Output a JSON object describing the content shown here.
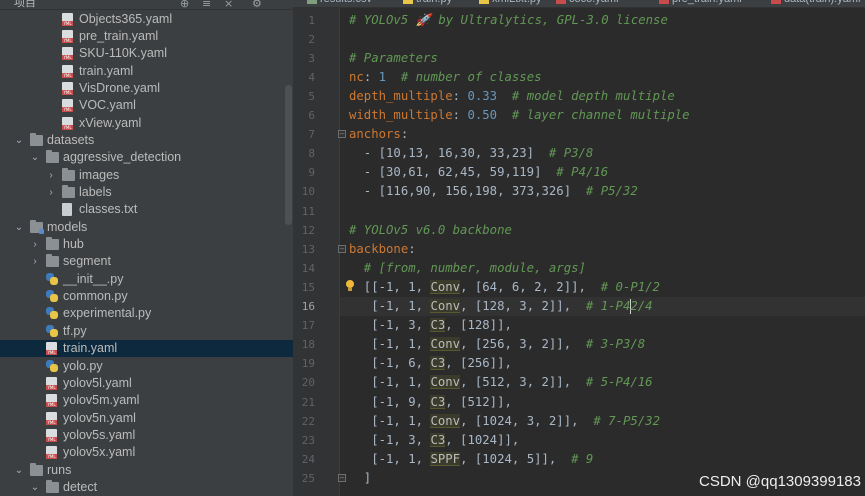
{
  "sidebar": {
    "project_label": "项目",
    "items": [
      {
        "label": "Objects365.yaml",
        "type": "yaml",
        "depth": 2
      },
      {
        "label": "pre_train.yaml",
        "type": "yaml",
        "depth": 2
      },
      {
        "label": "SKU-110K.yaml",
        "type": "yaml",
        "depth": 2
      },
      {
        "label": "train.yaml",
        "type": "yaml",
        "depth": 2
      },
      {
        "label": "VisDrone.yaml",
        "type": "yaml",
        "depth": 2
      },
      {
        "label": "VOC.yaml",
        "type": "yaml",
        "depth": 2
      },
      {
        "label": "xView.yaml",
        "type": "yaml",
        "depth": 2
      },
      {
        "label": "datasets",
        "type": "folder",
        "depth": 0,
        "expanded": true
      },
      {
        "label": "aggressive_detection",
        "type": "folder",
        "depth": 1,
        "expanded": true
      },
      {
        "label": "images",
        "type": "folder",
        "depth": 2,
        "expanded": false
      },
      {
        "label": "labels",
        "type": "folder",
        "depth": 2,
        "expanded": false
      },
      {
        "label": "classes.txt",
        "type": "txt",
        "depth": 2
      },
      {
        "label": "models",
        "type": "folder-mod",
        "depth": 0,
        "expanded": true
      },
      {
        "label": "hub",
        "type": "folder",
        "depth": 1,
        "expanded": false
      },
      {
        "label": "segment",
        "type": "folder",
        "depth": 1,
        "expanded": false
      },
      {
        "label": "__init__.py",
        "type": "py",
        "depth": 1
      },
      {
        "label": "common.py",
        "type": "py",
        "depth": 1
      },
      {
        "label": "experimental.py",
        "type": "py",
        "depth": 1
      },
      {
        "label": "tf.py",
        "type": "py",
        "depth": 1
      },
      {
        "label": "train.yaml",
        "type": "yaml",
        "depth": 1,
        "selected": true
      },
      {
        "label": "yolo.py",
        "type": "py",
        "depth": 1
      },
      {
        "label": "yolov5l.yaml",
        "type": "yaml",
        "depth": 1
      },
      {
        "label": "yolov5m.yaml",
        "type": "yaml",
        "depth": 1
      },
      {
        "label": "yolov5n.yaml",
        "type": "yaml",
        "depth": 1
      },
      {
        "label": "yolov5s.yaml",
        "type": "yaml",
        "depth": 1
      },
      {
        "label": "yolov5x.yaml",
        "type": "yaml",
        "depth": 1
      },
      {
        "label": "runs",
        "type": "folder",
        "depth": 0,
        "expanded": true
      },
      {
        "label": "detect",
        "type": "folder",
        "depth": 1,
        "expanded": true
      }
    ]
  },
  "tabs": [
    {
      "label": "results.csv",
      "icon": "csv"
    },
    {
      "label": "train.py",
      "icon": "py"
    },
    {
      "label": "xmlLtxt.py",
      "icon": "py"
    },
    {
      "label": "coco.yaml",
      "icon": "yaml"
    },
    {
      "label": "pre_train.yaml",
      "icon": "yaml"
    },
    {
      "label": "data(train).yaml",
      "icon": "yaml"
    }
  ],
  "editor": {
    "current_line": 16,
    "lines": [
      [
        {
          "t": "# YOLOv5 🚀 by Ultralytics, GPL-3.0 license",
          "c": "comment"
        }
      ],
      [],
      [
        {
          "t": "# Parameters",
          "c": "comment"
        }
      ],
      [
        {
          "t": "nc",
          "c": "key"
        },
        {
          "t": ": ",
          "c": "sym"
        },
        {
          "t": "1",
          "c": "num"
        },
        {
          "t": "  # number of classes",
          "c": "comment"
        }
      ],
      [
        {
          "t": "depth_multiple",
          "c": "key"
        },
        {
          "t": ": ",
          "c": "sym"
        },
        {
          "t": "0.33",
          "c": "num"
        },
        {
          "t": "  # model depth multiple",
          "c": "comment"
        }
      ],
      [
        {
          "t": "width_multiple",
          "c": "key"
        },
        {
          "t": ": ",
          "c": "sym"
        },
        {
          "t": "0.50",
          "c": "num"
        },
        {
          "t": "  # layer channel multiple",
          "c": "comment"
        }
      ],
      [
        {
          "t": "anchors",
          "c": "key"
        },
        {
          "t": ":",
          "c": "sym"
        }
      ],
      [
        {
          "t": "  - [10,13, 16,30, 33,23]",
          "c": "sym"
        },
        {
          "t": "  # P3/8",
          "c": "comment"
        }
      ],
      [
        {
          "t": "  - [30,61, 62,45, 59,119]",
          "c": "sym"
        },
        {
          "t": "  # P4/16",
          "c": "comment"
        }
      ],
      [
        {
          "t": "  - [116,90, 156,198, 373,326]",
          "c": "sym"
        },
        {
          "t": "  # P5/32",
          "c": "comment"
        }
      ],
      [],
      [
        {
          "t": "# YOLOv5 v6.0 backbone",
          "c": "comment"
        }
      ],
      [
        {
          "t": "backbone",
          "c": "key"
        },
        {
          "t": ":",
          "c": "sym"
        }
      ],
      [
        {
          "t": "  # [from, number, module, args]",
          "c": "comment"
        }
      ],
      [
        {
          "t": "  [[-1, 1, ",
          "c": "sym"
        },
        {
          "t": "Conv",
          "c": "hl"
        },
        {
          "t": ", [64, 6, 2, 2]],",
          "c": "sym"
        },
        {
          "t": "  # 0-P1/2",
          "c": "comment"
        }
      ],
      [
        {
          "t": "   [-1, 1, ",
          "c": "sym"
        },
        {
          "t": "Conv",
          "c": "hl"
        },
        {
          "t": ", [128, 3, 2]],",
          "c": "sym"
        },
        {
          "t": "  # 1-P4",
          "c": "comment"
        },
        {
          "t": "",
          "c": "caret"
        },
        {
          "t": "2/4",
          "c": "comment"
        }
      ],
      [
        {
          "t": "   [-1, 3, ",
          "c": "sym"
        },
        {
          "t": "C3",
          "c": "hl"
        },
        {
          "t": ", [128]],",
          "c": "sym"
        }
      ],
      [
        {
          "t": "   [-1, 1, ",
          "c": "sym"
        },
        {
          "t": "Conv",
          "c": "hl"
        },
        {
          "t": ", [256, 3, 2]],",
          "c": "sym"
        },
        {
          "t": "  # 3-P3/8",
          "c": "comment"
        }
      ],
      [
        {
          "t": "   [-1, 6, ",
          "c": "sym"
        },
        {
          "t": "C3",
          "c": "hl"
        },
        {
          "t": ", [256]],",
          "c": "sym"
        }
      ],
      [
        {
          "t": "   [-1, 1, ",
          "c": "sym"
        },
        {
          "t": "Conv",
          "c": "hl"
        },
        {
          "t": ", [512, 3, 2]],",
          "c": "sym"
        },
        {
          "t": "  # 5-P4/16",
          "c": "comment"
        }
      ],
      [
        {
          "t": "   [-1, 9, ",
          "c": "sym"
        },
        {
          "t": "C3",
          "c": "hl"
        },
        {
          "t": ", [512]],",
          "c": "sym"
        }
      ],
      [
        {
          "t": "   [-1, 1, ",
          "c": "sym"
        },
        {
          "t": "Conv",
          "c": "hl"
        },
        {
          "t": ", [1024, 3, 2]],",
          "c": "sym"
        },
        {
          "t": "  # 7-P5/32",
          "c": "comment"
        }
      ],
      [
        {
          "t": "   [-1, 3, ",
          "c": "sym"
        },
        {
          "t": "C3",
          "c": "hl"
        },
        {
          "t": ", [1024]],",
          "c": "sym"
        }
      ],
      [
        {
          "t": "   [-1, 1, ",
          "c": "sym"
        },
        {
          "t": "SPPF",
          "c": "hl"
        },
        {
          "t": ", [1024, 5]],",
          "c": "sym"
        },
        {
          "t": "  # 9",
          "c": "comment"
        }
      ],
      [
        {
          "t": "  ]",
          "c": "sym"
        }
      ]
    ]
  },
  "watermark": "CSDN @qq1309399183"
}
